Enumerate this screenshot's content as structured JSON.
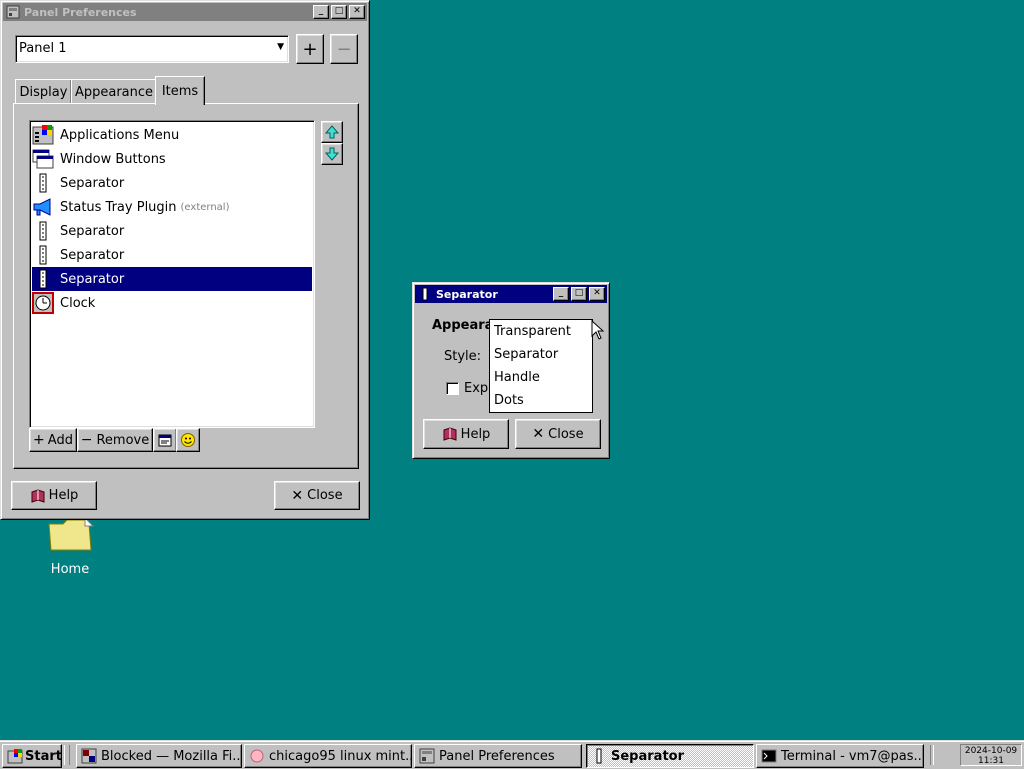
{
  "desktop": {
    "home_label": "Home"
  },
  "panel_prefs": {
    "title": "Panel Preferences",
    "panel_select": "Panel 1",
    "add_panel_symbol": "+",
    "remove_panel_symbol": "−",
    "tabs": [
      {
        "label": "Display"
      },
      {
        "label": "Appearance"
      },
      {
        "label": "Items"
      }
    ],
    "items": [
      {
        "label": "Applications Menu",
        "extra": "",
        "icon": "applications-menu-icon"
      },
      {
        "label": "Window Buttons",
        "extra": "",
        "icon": "window-buttons-icon"
      },
      {
        "label": "Separator",
        "extra": "",
        "icon": "separator-icon"
      },
      {
        "label": "Status Tray Plugin",
        "extra": "(external)",
        "icon": "megaphone-icon"
      },
      {
        "label": "Separator",
        "extra": "",
        "icon": "separator-icon"
      },
      {
        "label": "Separator",
        "extra": "",
        "icon": "separator-icon"
      },
      {
        "label": "Separator",
        "extra": "",
        "icon": "separator-icon",
        "selected": true
      },
      {
        "label": "Clock",
        "extra": "",
        "icon": "clock-icon"
      }
    ],
    "add_label": "Add",
    "remove_label": "Remove",
    "help_label": "Help",
    "close_label": "Close"
  },
  "separator_dialog": {
    "title": "Separator",
    "section_label": "Appearance",
    "style_label": "Style:",
    "expand_label": "Expand",
    "style_options": [
      "Transparent",
      "Separator",
      "Handle",
      "Dots"
    ],
    "help_label": "Help",
    "close_label": "Close"
  },
  "taskbar": {
    "start_label": "Start",
    "tasks": [
      {
        "label": "Blocked — Mozilla Fi..."
      },
      {
        "label": "chicago95 linux mint..."
      },
      {
        "label": "Panel Preferences"
      },
      {
        "label": "Separator"
      },
      {
        "label": "Terminal - vm7@pas..."
      }
    ],
    "clock_date": "2024-10-09",
    "clock_time": "11:31"
  },
  "colors": {
    "desktop": "#008080",
    "selection": "#000080",
    "face": "#c0c0c0"
  }
}
